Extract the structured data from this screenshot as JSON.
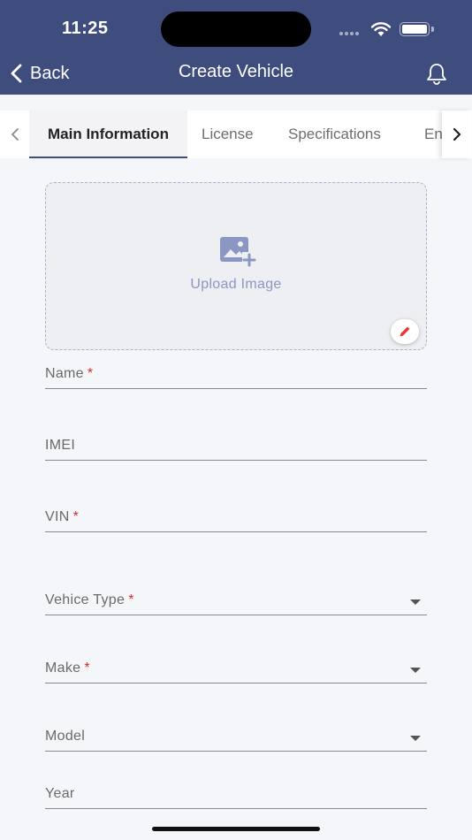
{
  "status_bar": {
    "time": "11:25"
  },
  "header": {
    "back_label": "Back",
    "title": "Create Vehicle"
  },
  "tabs": [
    {
      "label": "Main Information",
      "active": true
    },
    {
      "label": "License",
      "active": false
    },
    {
      "label": "Specifications",
      "active": false
    },
    {
      "label": "En",
      "active": false
    }
  ],
  "upload": {
    "label": "Upload Image"
  },
  "fields": {
    "name": {
      "label": "Name",
      "required": "*"
    },
    "imei": {
      "label": "IMEI"
    },
    "vin": {
      "label": "VIN",
      "required": "*"
    },
    "vehicle_type": {
      "label": "Vehice Type",
      "required": "*"
    },
    "make": {
      "label": "Make",
      "required": "*"
    },
    "model": {
      "label": "Model"
    },
    "year": {
      "label": "Year"
    }
  },
  "colors": {
    "header_bg": "#3f4c7e",
    "accent": "#3f4c7e",
    "required": "#d32f2f",
    "upload_text": "#8a97c2",
    "edit_icon": "#e53935"
  }
}
